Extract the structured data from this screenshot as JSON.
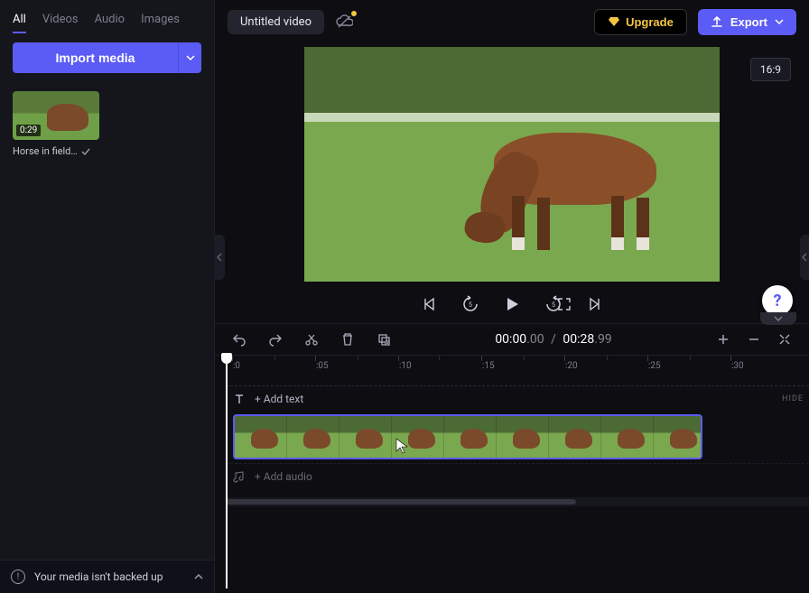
{
  "sidebar": {
    "tabs": [
      "All",
      "Videos",
      "Audio",
      "Images"
    ],
    "active_tab": 0,
    "import_label": "Import media",
    "media": [
      {
        "duration": "0:29",
        "name": "Horse in field…"
      }
    ],
    "backup_msg": "Your media isn't backed up"
  },
  "header": {
    "title": "Untitled video",
    "upgrade": "Upgrade",
    "export": "Export",
    "ratio": "16:9"
  },
  "timeline": {
    "current": {
      "main": "00:00",
      "frac": ".00"
    },
    "duration": {
      "main": "00:28",
      "frac": ".99"
    },
    "ticks": [
      ":0",
      ":05",
      ":10",
      ":15",
      ":20",
      ":25",
      ":30"
    ],
    "add_text": "+ Add text",
    "add_audio": "+ Add audio",
    "hide": "HIDE"
  }
}
